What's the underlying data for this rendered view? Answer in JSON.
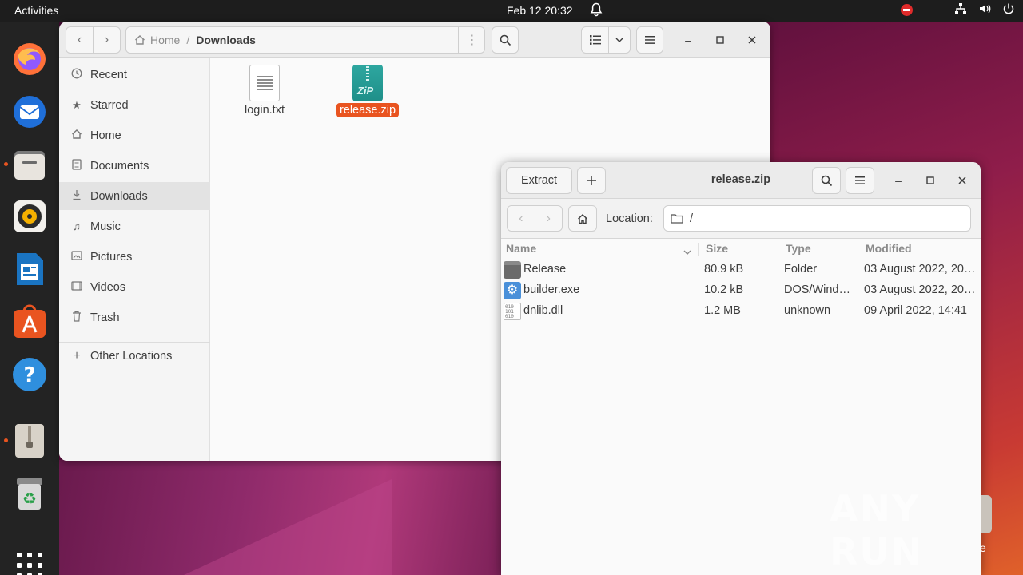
{
  "topbar": {
    "activities": "Activities",
    "clock": "Feb 12  20:32"
  },
  "dock": {
    "items": [
      "firefox-icon",
      "thunderbird-icon",
      "files-icon",
      "rhythmbox-icon",
      "writer-icon",
      "app-center-icon",
      "help-icon",
      "archive-manager-icon",
      "trash-icon",
      "show-apps-icon"
    ]
  },
  "files_window": {
    "path_home": "Home",
    "path_separator": "/",
    "path_current": "Downloads",
    "sidebar": {
      "items": [
        {
          "label": "Recent",
          "icon": "clock-icon"
        },
        {
          "label": "Starred",
          "icon": "star-icon"
        },
        {
          "label": "Home",
          "icon": "home-icon"
        },
        {
          "label": "Documents",
          "icon": "document-icon"
        },
        {
          "label": "Downloads",
          "icon": "download-icon"
        },
        {
          "label": "Music",
          "icon": "music-icon"
        },
        {
          "label": "Pictures",
          "icon": "picture-icon"
        },
        {
          "label": "Videos",
          "icon": "video-icon"
        },
        {
          "label": "Trash",
          "icon": "trash-icon"
        }
      ],
      "other_locations": "Other Locations"
    },
    "files": [
      {
        "name": "login.txt",
        "type": "text"
      },
      {
        "name": "release.zip",
        "type": "zip",
        "selected": true
      }
    ]
  },
  "archive_window": {
    "title": "release.zip",
    "extract_label": "Extract",
    "location_label": "Location:",
    "location_value": "/",
    "columns": [
      "Name",
      "Size",
      "Type",
      "Modified"
    ],
    "rows": [
      {
        "name": "Release",
        "size": "80.9 kB",
        "type": "Folder",
        "modified": "03 August 2022, 20…"
      },
      {
        "name": "builder.exe",
        "size": "10.2 kB",
        "type": "DOS/Wind…",
        "modified": "03 August 2022, 20…"
      },
      {
        "name": "dnlib.dll",
        "size": "1.2 MB",
        "type": "unknown",
        "modified": "09 April 2022, 14:41"
      }
    ]
  },
  "watermark": "ANY RUN",
  "colors": {
    "accent": "#e95420",
    "topbar": "#1d1d1d",
    "dock": "#232323"
  }
}
